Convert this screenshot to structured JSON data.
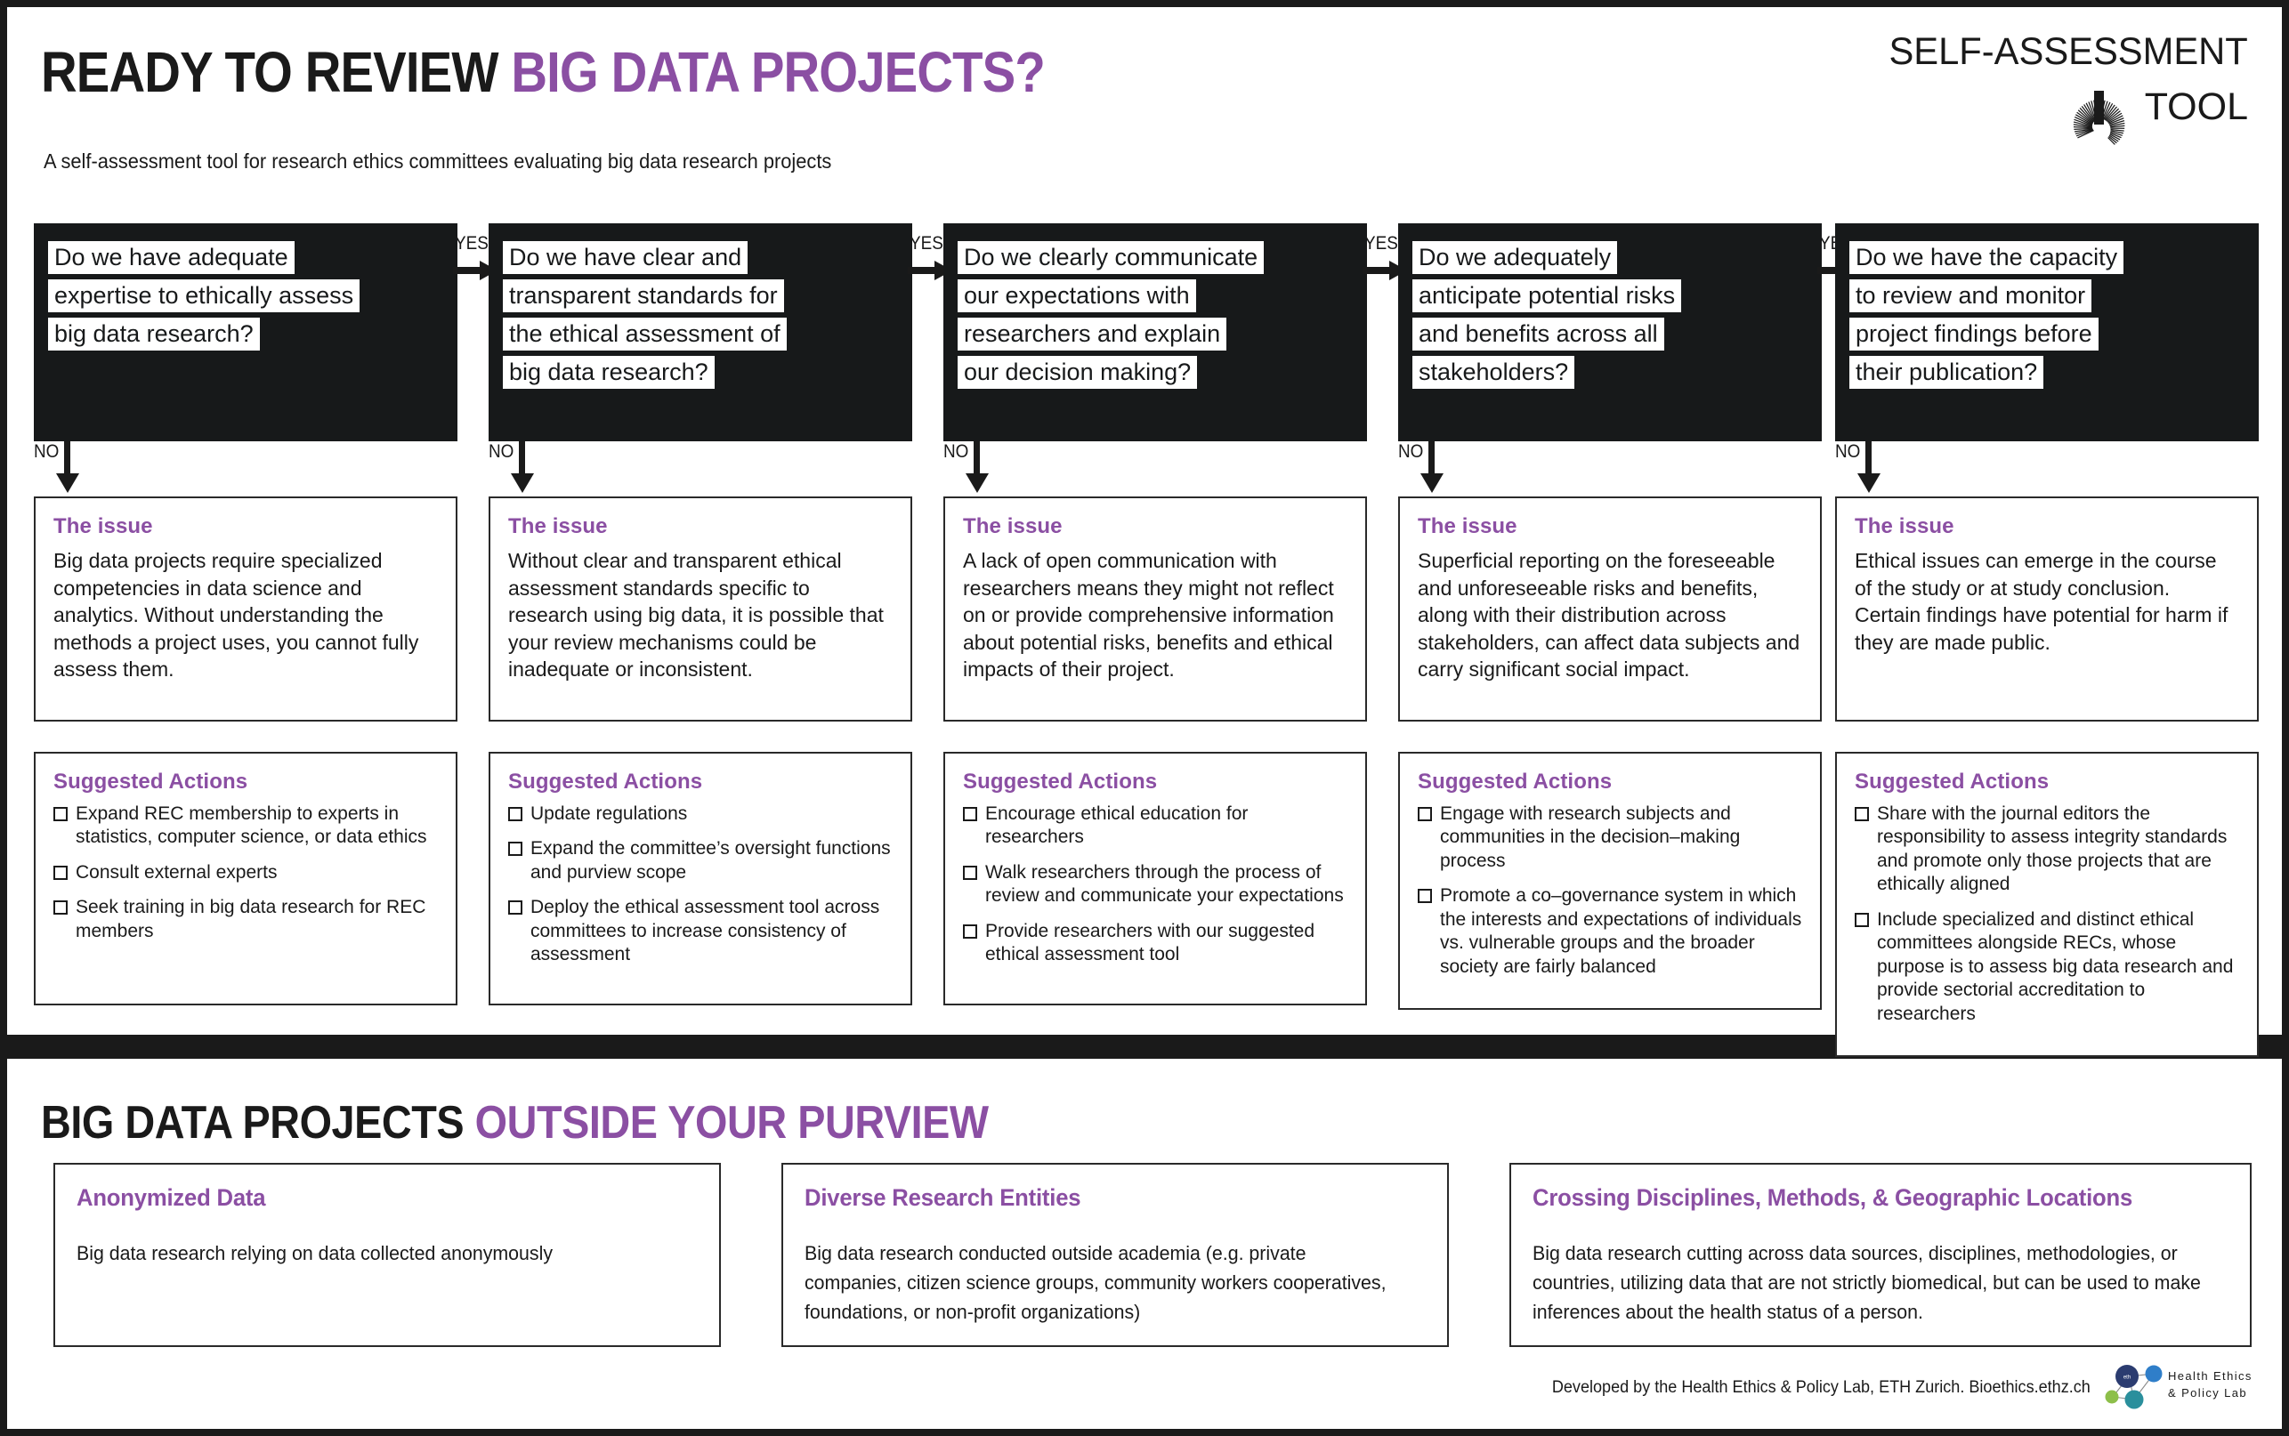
{
  "header": {
    "title_dark": "READY TO REVIEW ",
    "title_accent": "BIG DATA PROJECTS?",
    "subtitle": "A self-assessment tool for research ethics committees evaluating big data research projects",
    "brand_line1": "SELF-ASSESSMENT",
    "brand_line2": "TOOL",
    "brand_logo_icon": "spiral-burst-icon"
  },
  "colors": {
    "accent_purple": "#8b4fa3",
    "dark": "#17191a",
    "white": "#ffffff",
    "border": "#2a2a2a"
  },
  "labels": {
    "yes": "YES",
    "no": "NO",
    "issue_heading": "The issue",
    "actions_heading": "Suggested Actions"
  },
  "flow": {
    "columns": [
      {
        "question_lines": [
          "Do we have adequate",
          "expertise to ethically assess",
          "big data research?"
        ],
        "issue": "Big data projects require specialized competencies in data science and analytics. Without understanding the methods a project uses, you cannot fully assess them.",
        "actions": [
          "Expand REC membership to experts in statistics, computer science, or data ethics",
          "Consult external experts",
          "Seek training in big data research for REC members"
        ]
      },
      {
        "question_lines": [
          "Do we have clear and",
          "transparent standards for",
          "the ethical assessment of",
          "big data research?"
        ],
        "issue": "Without clear and transparent ethical assessment standards specific to research using big data, it is possible that your review mechanisms could be inadequate or inconsistent.",
        "actions": [
          "Update regulations",
          "Expand the committee’s oversight functions and purview scope",
          "Deploy the ethical assessment tool across committees to increase consistency of assessment"
        ]
      },
      {
        "question_lines": [
          "Do we clearly communicate",
          "our expectations with",
          "researchers and explain",
          "our decision making?"
        ],
        "issue": "A lack of open communication with researchers means they might not reflect  on or provide comprehensive information about potential risks, benefits and ethical impacts of their project.",
        "actions": [
          "Encourage ethical education for researchers",
          "Walk researchers through the process of review and communicate your expectations",
          "Provide researchers with our suggested ethical assessment tool"
        ]
      },
      {
        "question_lines": [
          "Do we adequately",
          "anticipate potential risks",
          "and benefits across all",
          "stakeholders?"
        ],
        "issue": "Superficial reporting on the foreseeable and unforeseeable risks and benefits, along with their distribution across stakeholders, can affect data subjects and carry significant social impact.",
        "actions": [
          "Engage with research subjects and communities in the decision–making process",
          "Promote a co–governance system in which the interests and expectations of individuals vs. vulnerable groups and the broader society are fairly balanced"
        ]
      },
      {
        "question_lines": [
          "Do we have the capacity",
          "to review and monitor",
          "project findings before",
          "their publication?"
        ],
        "issue": "Ethical issues can emerge in the course of the study or at study conclusion. Certain findings have potential for harm if they are made public.",
        "actions": [
          "Share with the journal editors the responsibility to assess integrity standards and promote only those projects that are ethically aligned",
          "Include specialized and distinct ethical committees alongside RECs, whose purpose is to assess big data research and provide sectorial accreditation to researchers"
        ]
      }
    ]
  },
  "bottom": {
    "title_dark": "BIG DATA PROJECTS ",
    "title_accent": "OUTSIDE YOUR PURVIEW",
    "cards": [
      {
        "heading": "Anonymized Data",
        "body": "Big data research relying on data collected anonymously"
      },
      {
        "heading": "Diverse Research Entities",
        "body": "Big data research conducted outside academia (e.g. private companies, citizen science groups, community workers cooperatives, foundations, or non-profit organizations)"
      },
      {
        "heading": "Crossing Disciplines, Methods, & Geographic Locations",
        "body": "Big data research cutting across data sources, disciplines, methodologies, or countries, utilizing data that are not strictly biomedical, but can be used to make inferences about the health status of a person."
      }
    ],
    "credit": "Developed by the Health Ethics & Policy Lab, ETH Zurich. Bioethics.ethz.ch",
    "footer_logo_line1": "Health Ethics",
    "footer_logo_line2": "& Policy Lab",
    "footer_logo_icon": "network-nodes-icon"
  }
}
